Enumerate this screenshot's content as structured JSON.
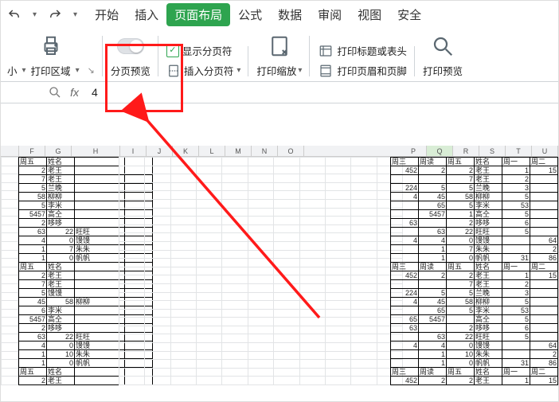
{
  "qat": {
    "undo_tip": "撤消",
    "redo_tip": "重做"
  },
  "tabs": [
    "开始",
    "插入",
    "页面布局",
    "公式",
    "数据",
    "审阅",
    "视图",
    "安全"
  ],
  "active_tab": 2,
  "ribbon": {
    "print_area_small": "小",
    "print_area": "打印区域",
    "page_break_preview": "分页预览",
    "show_page_breaks": "显示分页符",
    "insert_page_break": "插入分页符",
    "print_scale": "打印缩放",
    "print_titles": "打印标题或表头",
    "print_hf": "打印页眉和页脚",
    "print_preview": "打印预览"
  },
  "formula_bar": {
    "value": "4"
  },
  "columns_left": [
    "F",
    "G",
    "H",
    "I",
    "J",
    "K",
    "L",
    "M",
    "N",
    "O"
  ],
  "columns_right": [
    "P",
    "Q",
    "R",
    "S",
    "T",
    "U"
  ],
  "left_block": [
    [
      "周五",
      "姓名",
      "",
      ""
    ],
    [
      "2",
      "老王",
      "",
      ""
    ],
    [
      "7",
      "老王",
      "",
      ""
    ],
    [
      "5",
      "兰晚",
      "",
      ""
    ],
    [
      "58",
      "柳柳",
      "",
      ""
    ],
    [
      "5",
      "李米",
      "",
      ""
    ],
    [
      "5457",
      "高仝",
      "",
      ""
    ],
    [
      "2",
      "哆哆",
      "",
      ""
    ],
    [
      "63",
      "22",
      "旺旺",
      ""
    ],
    [
      "4",
      "0",
      "馒馒",
      ""
    ],
    [
      "1",
      "7",
      "朱朱",
      ""
    ],
    [
      "1",
      "0",
      "帆帆",
      ""
    ],
    [
      "周五",
      "姓名",
      "",
      ""
    ],
    [
      "2",
      "老王",
      "",
      ""
    ],
    [
      "7",
      "老王",
      "",
      ""
    ],
    [
      "5",
      "馒馒",
      "",
      ""
    ],
    [
      "45",
      "58",
      "柳柳",
      ""
    ],
    [
      "6",
      "李米",
      "",
      ""
    ],
    [
      "5457",
      "高仝",
      "",
      ""
    ],
    [
      "2",
      "哆哆",
      "",
      ""
    ],
    [
      "63",
      "22",
      "旺旺",
      ""
    ],
    [
      "4",
      "0",
      "馒馒",
      ""
    ],
    [
      "1",
      "10",
      "朱朱",
      ""
    ],
    [
      "1",
      "0",
      "帆帆",
      ""
    ],
    [
      "周五",
      "姓名",
      "",
      ""
    ],
    [
      "2",
      "老王",
      "",
      ""
    ]
  ],
  "right_block": [
    [
      "周三",
      "周读",
      "周五",
      "姓名",
      "周一",
      "周二"
    ],
    [
      "452",
      "2",
      "2",
      "老王",
      "1",
      "15"
    ],
    [
      "",
      "",
      "7",
      "老王",
      "2",
      ""
    ],
    [
      "224",
      "5",
      "5",
      "兰晚",
      "3",
      ""
    ],
    [
      "4",
      "45",
      "58",
      "柳柳",
      "5",
      ""
    ],
    [
      "",
      "65",
      "5",
      "李米",
      "53",
      ""
    ],
    [
      "",
      "5457",
      "1",
      "高仝",
      "5",
      ""
    ],
    [
      "63",
      "",
      "2",
      "哆哆",
      "6",
      ""
    ],
    [
      "",
      "63",
      "22",
      "旺旺",
      "5",
      ""
    ],
    [
      "4",
      "4",
      "0",
      "馒馒",
      "",
      "64"
    ],
    [
      "",
      "1",
      "7",
      "朱朱",
      "",
      "2"
    ],
    [
      "",
      "1",
      "0",
      "帆帆",
      "31",
      "86"
    ],
    [
      "周三",
      "周读",
      "周五",
      "姓名",
      "周一",
      "周二"
    ],
    [
      "452",
      "2",
      "2",
      "老王",
      "1",
      "15"
    ],
    [
      "",
      "",
      "7",
      "老王",
      "2",
      ""
    ],
    [
      "224",
      "5",
      "5",
      "兰晚",
      "3",
      ""
    ],
    [
      "4",
      "45",
      "58",
      "柳柳",
      "5",
      ""
    ],
    [
      "",
      "65",
      "5",
      "李米",
      "53",
      ""
    ],
    [
      "65",
      "5457",
      "",
      "高仝",
      "5",
      ""
    ],
    [
      "63",
      "",
      "2",
      "哆哆",
      "6",
      ""
    ],
    [
      "",
      "63",
      "22",
      "旺旺",
      "5",
      ""
    ],
    [
      "4",
      "4",
      "0",
      "馒馒",
      "",
      "64"
    ],
    [
      "",
      "1",
      "10",
      "朱朱",
      "",
      "2"
    ],
    [
      "",
      "1",
      "0",
      "帆帆",
      "31",
      "86"
    ],
    [
      "周三",
      "周读",
      "周五",
      "姓名",
      "周一",
      "周二"
    ],
    [
      "452",
      "2",
      "2",
      "老王",
      "1",
      "15"
    ]
  ],
  "chart_data": null
}
